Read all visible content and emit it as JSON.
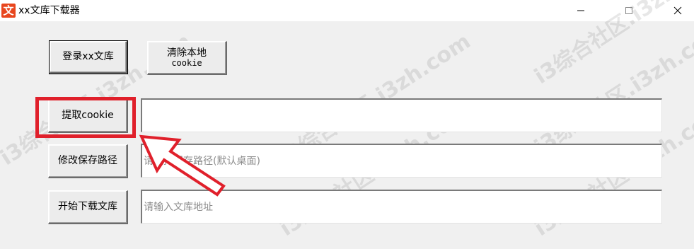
{
  "window": {
    "app_icon_glyph": "文",
    "title": "xx文库下载器"
  },
  "buttons": {
    "login": "登录xx文库",
    "clear_cookie_line1": "清除本地",
    "clear_cookie_line2": "cookie",
    "get_cookie": "提取cookie",
    "change_path": "修改保存路径",
    "start_download": "开始下载文库"
  },
  "fields": {
    "cookie_value": "",
    "save_path_placeholder": "请选择保存路径(默认桌面)",
    "url_placeholder": "请输入文库地址"
  },
  "watermark": "i3综合社区.i3zh.com",
  "colors": {
    "highlight": "#e0202b",
    "app_icon": "#e8461e"
  }
}
